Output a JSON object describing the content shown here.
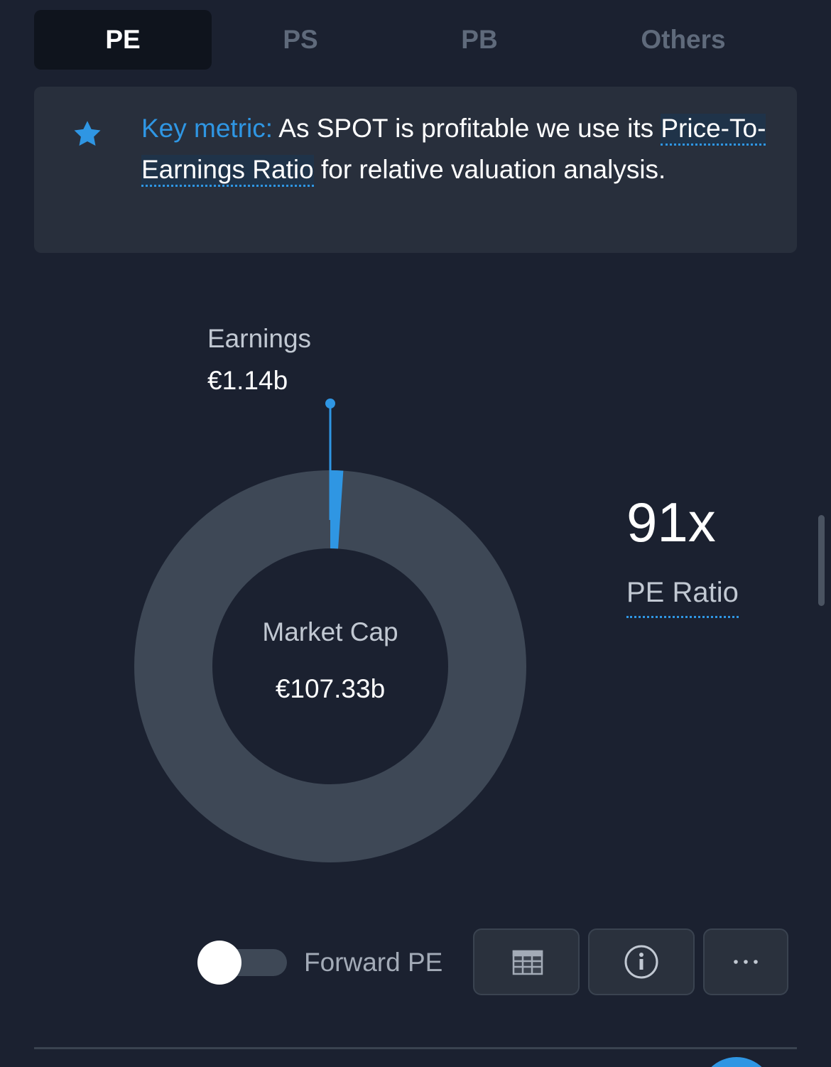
{
  "tabs": [
    {
      "label": "PE",
      "active": true
    },
    {
      "label": "PS",
      "active": false
    },
    {
      "label": "PB",
      "active": false
    },
    {
      "label": "Others",
      "active": false
    }
  ],
  "key_metric": {
    "label": "Key metric:",
    "text_before": " As SPOT is profitable we use its ",
    "link": "Price-To-Earnings Ratio",
    "text_after": " for relative valuation analysis.",
    "icon": "star-icon"
  },
  "chart": {
    "earnings_label": "Earnings",
    "earnings_value": "€1.14b",
    "center_label": "Market Cap",
    "center_value": "€107.33b",
    "earnings_share": 0.0106
  },
  "ratio": {
    "value": "91x",
    "label": "PE Ratio"
  },
  "controls": {
    "toggle_label": "Forward PE",
    "toggle_on": false,
    "table_icon": "table-icon",
    "info_icon": "info-icon",
    "more_icon": "more-icon"
  },
  "colors": {
    "background": "#1b2130",
    "accent": "#2f96e3",
    "ring": "#3e4856"
  }
}
